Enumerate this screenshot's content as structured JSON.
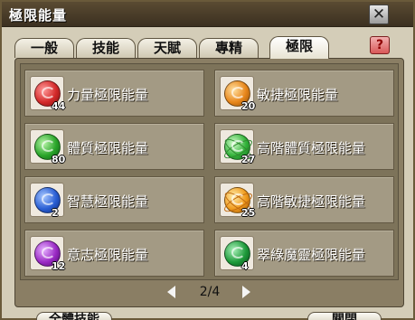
{
  "window": {
    "title": "極限能量",
    "close_glyph": "✕"
  },
  "tabs": [
    {
      "label": "一般",
      "active": false
    },
    {
      "label": "技能",
      "active": false
    },
    {
      "label": "天賦",
      "active": false
    },
    {
      "label": "專精",
      "active": false
    },
    {
      "label": "極限",
      "active": true
    }
  ],
  "help_glyph": "?",
  "slots": [
    {
      "label": "力量極限能量",
      "count": "44",
      "icon": "red-energy-orb-icon",
      "color": "#d42a2a"
    },
    {
      "label": "敏捷極限能量",
      "count": "20",
      "icon": "orange-energy-orb-icon",
      "color": "#e8861a"
    },
    {
      "label": "體質極限能量",
      "count": "80",
      "icon": "green-energy-orb-icon",
      "color": "#2aa52a"
    },
    {
      "label": "高階體質極限能量",
      "count": "27",
      "icon": "green-orbit-orb-icon",
      "color": "#33b33a"
    },
    {
      "label": "智慧極限能量",
      "count": "2",
      "icon": "blue-energy-orb-icon",
      "color": "#2a5fd4"
    },
    {
      "label": "高階敏捷極限能量",
      "count": "25",
      "icon": "orange-orbit-orb-icon",
      "color": "#f09a1c"
    },
    {
      "label": "意志極限能量",
      "count": "12",
      "icon": "purple-energy-orb-icon",
      "color": "#9a2ac4"
    },
    {
      "label": "翠綠魔靈極限能量",
      "count": "4",
      "icon": "emerald-energy-orb-icon",
      "color": "#1e9a3a"
    }
  ],
  "pager": {
    "text": "2/4"
  },
  "footer": {
    "left_button": "全體技能",
    "right_button": "關閉"
  }
}
